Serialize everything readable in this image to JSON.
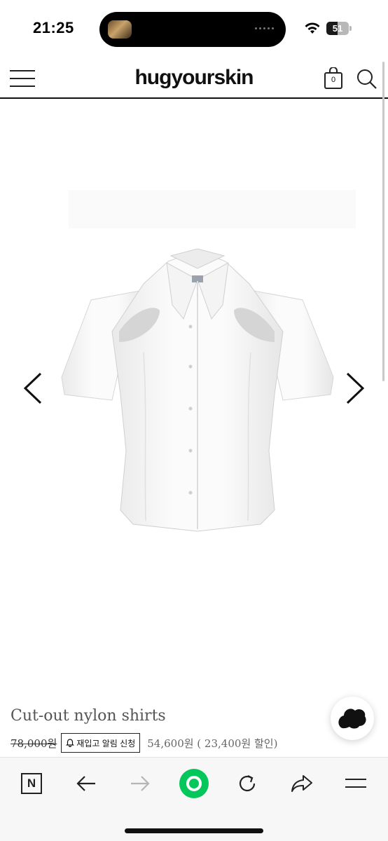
{
  "status_bar": {
    "time": "21:25",
    "battery_level": "51",
    "icons": [
      "now-playing-thumbnail-icon",
      "wifi-icon",
      "battery-icon"
    ]
  },
  "header": {
    "logo": "hugyourskin",
    "cart_count": "0",
    "icons": [
      "hamburger-menu-icon",
      "shopping-bag-icon",
      "search-icon"
    ]
  },
  "gallery": {
    "icons": [
      "chevron-left-icon",
      "chevron-right-icon"
    ]
  },
  "product": {
    "name": "Cut-out nylon shirts",
    "original_price": "78,000원",
    "restock_label": "재입고 알림 신청",
    "sale_price": "54,600원 ( 23,400원 할인)"
  },
  "chat": {
    "icon": "chat-blob-icon"
  },
  "browser_toolbar": {
    "n_label": "N",
    "icons": [
      "naver-n-icon",
      "back-arrow-icon",
      "forward-arrow-icon",
      "green-dot-icon",
      "reload-icon",
      "share-icon",
      "menu-icon"
    ],
    "accent_color": "#03c75a"
  }
}
